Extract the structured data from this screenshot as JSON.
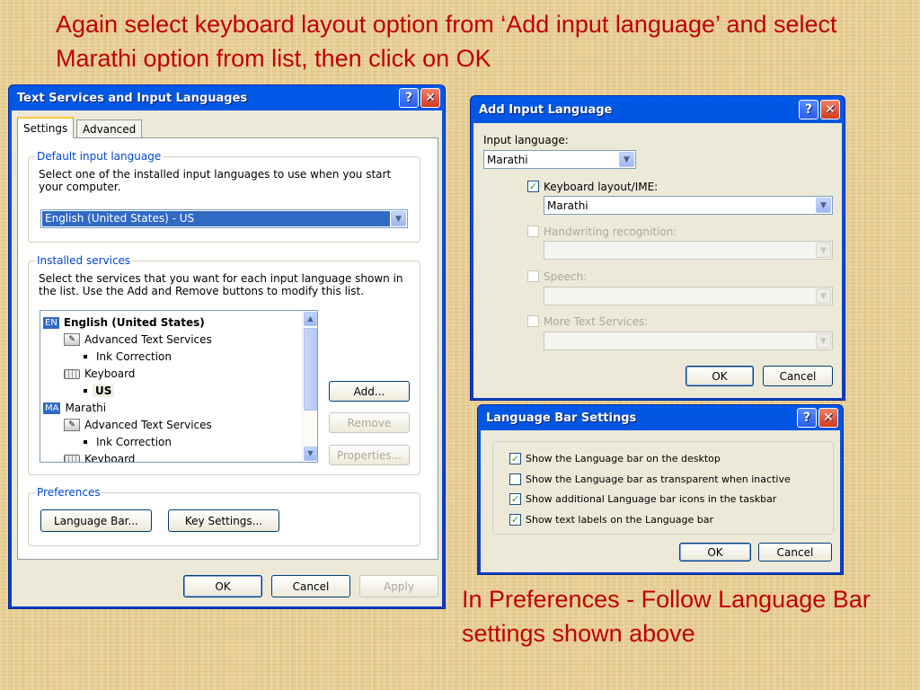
{
  "slide": {
    "title": "Again select keyboard layout option from ‘Add input  language’ and select Marathi option from list, then click on OK",
    "caption": "In Preferences - Follow Language Bar settings shown above"
  },
  "text_services": {
    "title": "Text Services and Input Languages",
    "tabs": [
      "Settings",
      "Advanced"
    ],
    "default_group": {
      "label": "Default input language",
      "description": "Select one of the installed input languages to use when you start your computer.",
      "selected": "English (United States) - US"
    },
    "installed_group": {
      "label": "Installed services",
      "description": "Select the services that you want for each input language shown in the list. Use the Add and Remove buttons to modify this list.",
      "tree": {
        "en_badge": "EN",
        "en_lang": "English (United States)",
        "en_ats": "Advanced Text Services",
        "en_ink": "Ink Correction",
        "en_kbd": "Keyboard",
        "en_us": "US",
        "ma_badge": "MA",
        "ma_lang": "Marathi",
        "ma_ats": "Advanced Text Services",
        "ma_ink": "Ink Correction",
        "ma_kbd": "Keyboard"
      },
      "add": "Add...",
      "remove": "Remove",
      "properties": "Properties..."
    },
    "preferences": {
      "label": "Preferences",
      "language_bar": "Language Bar...",
      "key_settings": "Key Settings..."
    },
    "ok": "OK",
    "cancel": "Cancel",
    "apply": "Apply"
  },
  "add_input": {
    "title": "Add Input Language",
    "input_language_label": "Input language:",
    "input_language_value": "Marathi",
    "keyboard_label": "Keyboard layout/IME:",
    "keyboard_value": "Marathi",
    "handwriting_label": "Handwriting recognition:",
    "speech_label": "Speech:",
    "more_label": "More Text Services:",
    "ok": "OK",
    "cancel": "Cancel"
  },
  "language_bar": {
    "title": "Language Bar Settings",
    "options": [
      {
        "label": "Show the Language bar on the desktop",
        "checked": true
      },
      {
        "label": "Show the Language bar as transparent when inactive",
        "checked": false
      },
      {
        "label": "Show additional Language bar icons in the taskbar",
        "checked": true
      },
      {
        "label": "Show text labels on the Language bar",
        "checked": true
      }
    ],
    "ok": "OK",
    "cancel": "Cancel"
  },
  "colors": {
    "slide_text": "#c00000",
    "xp_title_blue": "#0058e6",
    "dialog_face": "#ece9d8",
    "selection": "#316ac5"
  }
}
